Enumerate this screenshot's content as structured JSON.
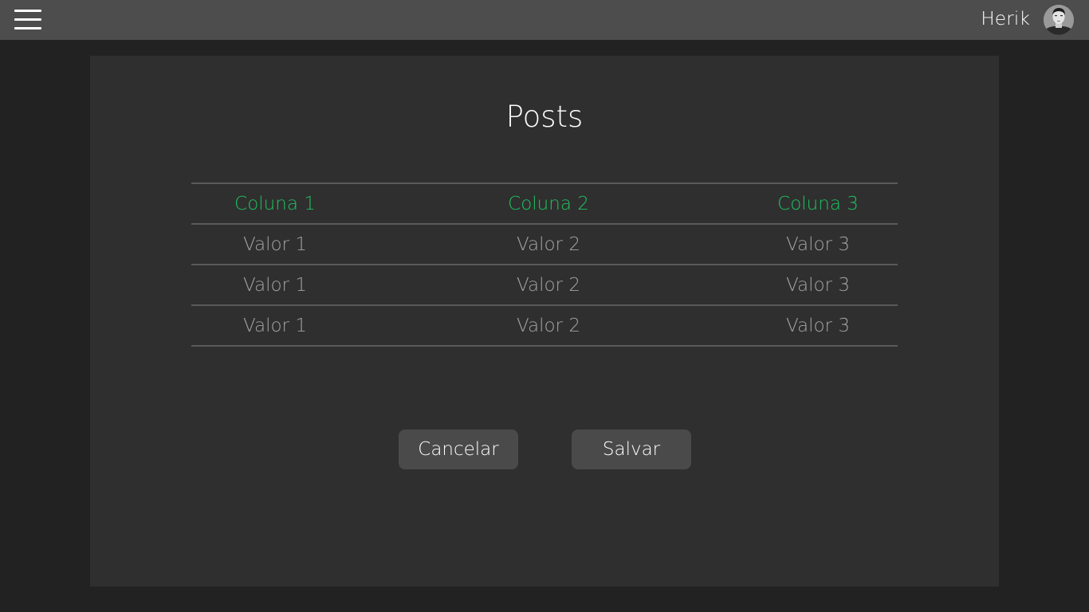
{
  "header": {
    "user_name": "Herik",
    "menu_icon": "hamburger-menu-icon",
    "avatar_icon": "user-avatar"
  },
  "main": {
    "title": "Posts",
    "table": {
      "columns": [
        "Coluna 1",
        "Coluna 2",
        "Coluna 3"
      ],
      "rows": [
        [
          "Valor 1",
          "Valor 2",
          "Valor 3"
        ],
        [
          "Valor 1",
          "Valor 2",
          "Valor 3"
        ],
        [
          "Valor 1",
          "Valor 2",
          "Valor 3"
        ]
      ]
    },
    "actions": {
      "cancel_label": "Cancelar",
      "save_label": "Salvar"
    }
  },
  "colors": {
    "topbar": "#4d4d4d",
    "background": "#222222",
    "panel": "#2f2f2f",
    "header_text": "#1fc05f",
    "cell_text": "#a3a3a3",
    "button": "#4a4a4a"
  }
}
